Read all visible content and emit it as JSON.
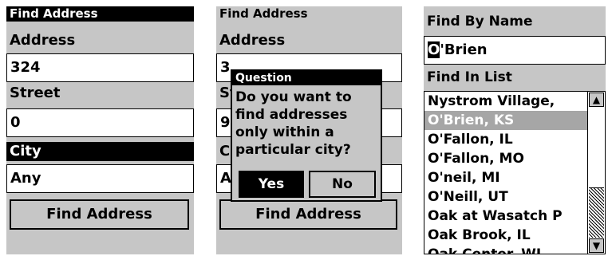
{
  "panel1": {
    "title": "Find Address",
    "address_label": "Address",
    "address_value": "324",
    "street_label": "Street",
    "street_value": "0",
    "city_label": "City",
    "city_value": "Any",
    "find_button": "Find Address"
  },
  "panel2": {
    "title": "Find Address",
    "address_label": "Address",
    "address_value_partial": "3",
    "street_label_partial": "St",
    "street_value_partial": "9",
    "city_label_partial": "C",
    "city_value_partial": "A",
    "find_button": "Find Address",
    "dialog": {
      "title": "Question",
      "message": "Do you want to find addresses only within a particular city?",
      "yes": "Yes",
      "no": "No"
    }
  },
  "panel3": {
    "title": "Find By Name",
    "name_first_char": "O",
    "name_rest": "'Brien",
    "list_label": "Find In List",
    "items": [
      "Nystrom Village,",
      "O'Brien, KS",
      "O'Fallon, IL",
      "O'Fallon, MO",
      "O'neil, MI",
      "O'Neill, UT",
      "Oak at Wasatch P",
      "Oak Brook, IL",
      "Oak Center, WI"
    ],
    "selected_index": 1
  },
  "colors": {
    "panel_bg": "#c6c6c6",
    "selection_bg": "#a6a6a6",
    "title_bg": "#000000"
  }
}
